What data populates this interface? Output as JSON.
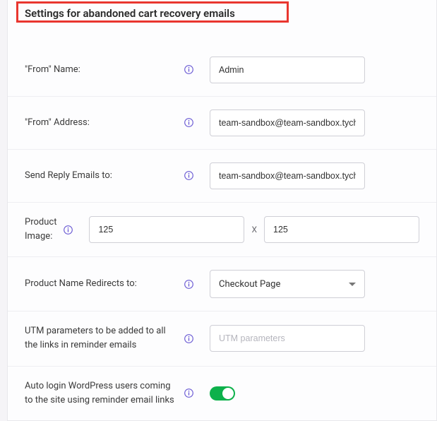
{
  "heading": "Settings for abandoned cart recovery emails",
  "fields": {
    "fromName": {
      "label": "\"From\" Name:",
      "value": "Admin"
    },
    "fromAddress": {
      "label": "\"From\" Address:",
      "value": "team-sandbox@team-sandbox.tychesol"
    },
    "replyTo": {
      "label": "Send Reply Emails to:",
      "value": "team-sandbox@team-sandbox.tychesol"
    },
    "productImage": {
      "label": "Product Image:",
      "width": "125",
      "height": "125",
      "sep": "X"
    },
    "redirect": {
      "label": "Product Name Redirects to:",
      "selected": "Checkout Page"
    },
    "utm": {
      "label": "UTM parameters to be added to all the links in reminder emails",
      "placeholder": "UTM parameters",
      "value": ""
    },
    "autologin": {
      "label": "Auto login WordPress users coming to the site using reminder email links",
      "enabled": true
    }
  }
}
